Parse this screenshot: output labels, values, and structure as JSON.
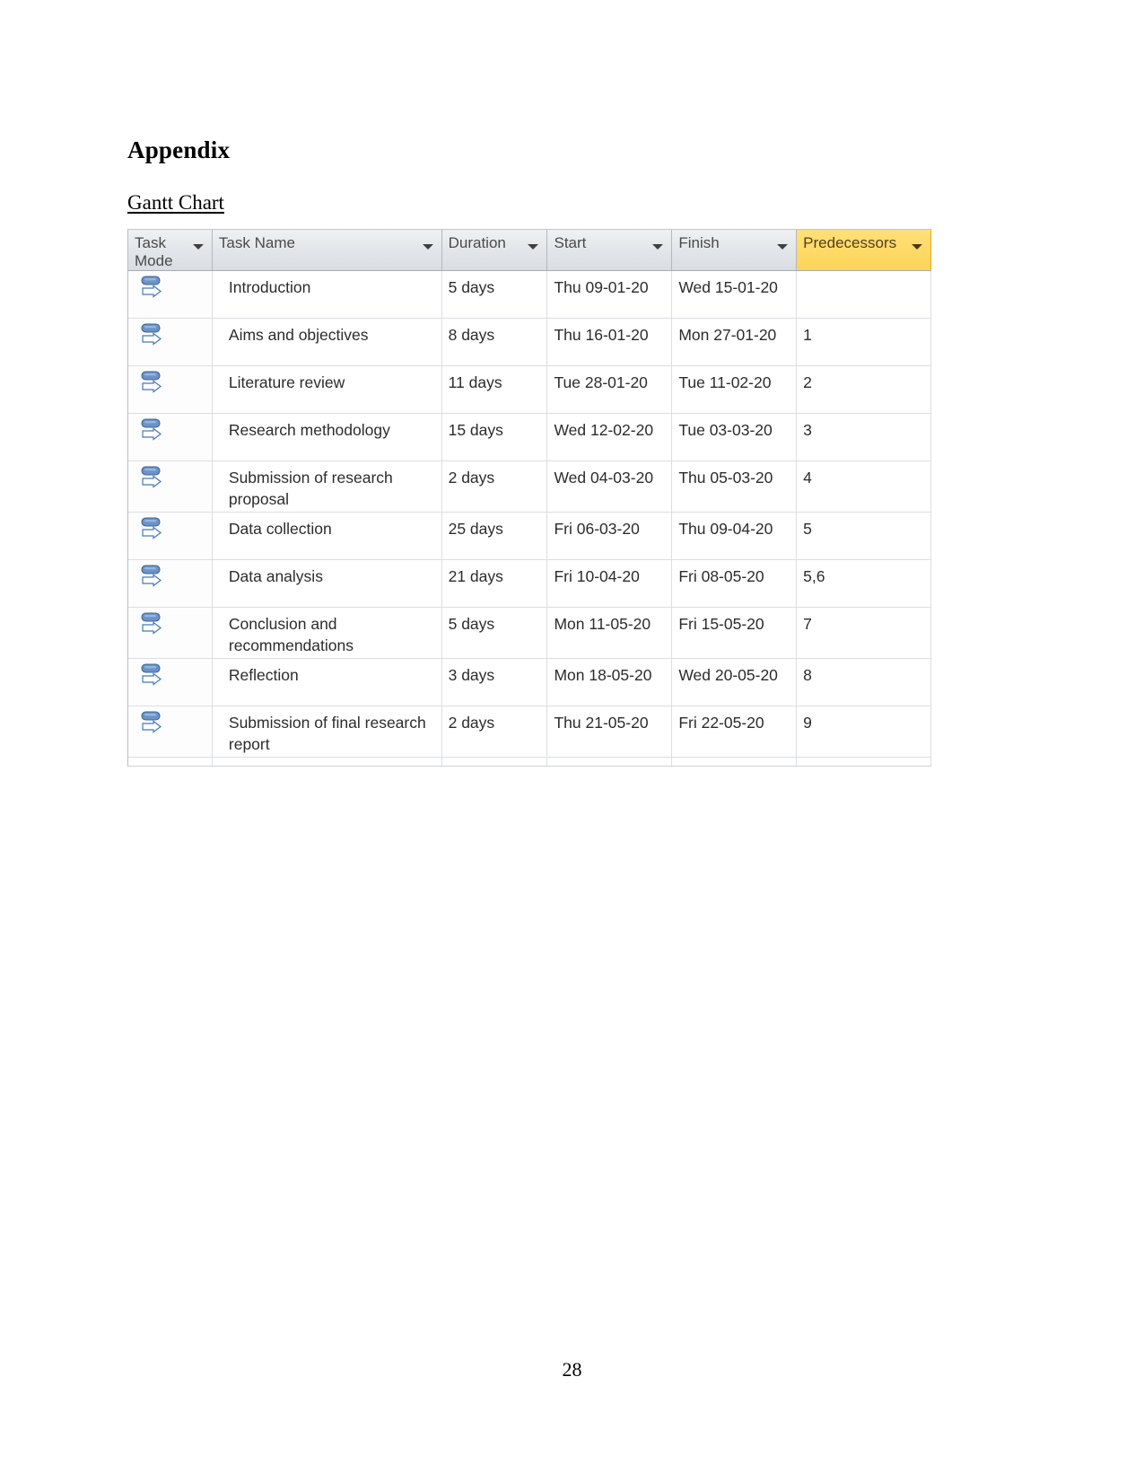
{
  "document": {
    "appendix_heading": "Appendix",
    "section_label": "Gantt Chart",
    "page_number": "28"
  },
  "colors": {
    "header_highlight": "#ffda66",
    "header_background": "#e2e5e9",
    "task_mode_icon": "#5b83b8",
    "grid_line": "#dcdee1"
  },
  "table": {
    "columns": [
      {
        "key": "mode",
        "label": "Task\nMode",
        "icon": "chevron-down-icon",
        "highlighted": false
      },
      {
        "key": "name",
        "label": "Task Name",
        "icon": "chevron-down-icon",
        "highlighted": false
      },
      {
        "key": "dur",
        "label": "Duration",
        "icon": "chevron-down-icon",
        "highlighted": false
      },
      {
        "key": "start",
        "label": "Start",
        "icon": "chevron-down-icon",
        "highlighted": false
      },
      {
        "key": "finish",
        "label": "Finish",
        "icon": "chevron-down-icon",
        "highlighted": false
      },
      {
        "key": "pred",
        "label": "Predecessors",
        "icon": "chevron-down-icon",
        "highlighted": true
      }
    ],
    "rows": [
      {
        "mode_icon": "auto-scheduled-icon",
        "name": "Introduction",
        "duration": "5 days",
        "start": "Thu 09-01-20",
        "finish": "Wed 15-01-20",
        "predecessors": ""
      },
      {
        "mode_icon": "auto-scheduled-icon",
        "name": "Aims and objectives",
        "duration": "8 days",
        "start": "Thu 16-01-20",
        "finish": "Mon 27-01-20",
        "predecessors": "1"
      },
      {
        "mode_icon": "auto-scheduled-icon",
        "name": "Literature review",
        "duration": "11 days",
        "start": "Tue 28-01-20",
        "finish": "Tue 11-02-20",
        "predecessors": "2"
      },
      {
        "mode_icon": "auto-scheduled-icon",
        "name": "Research methodology",
        "duration": "15 days",
        "start": "Wed 12-02-20",
        "finish": "Tue 03-03-20",
        "predecessors": "3"
      },
      {
        "mode_icon": "auto-scheduled-icon",
        "name": "Submission of research proposal",
        "duration": "2 days",
        "start": "Wed 04-03-20",
        "finish": "Thu 05-03-20",
        "predecessors": "4"
      },
      {
        "mode_icon": "auto-scheduled-icon",
        "name": "Data collection",
        "duration": "25 days",
        "start": "Fri 06-03-20",
        "finish": "Thu 09-04-20",
        "predecessors": "5"
      },
      {
        "mode_icon": "auto-scheduled-icon",
        "name": "Data analysis",
        "duration": "21 days",
        "start": "Fri 10-04-20",
        "finish": "Fri 08-05-20",
        "predecessors": "5,6"
      },
      {
        "mode_icon": "auto-scheduled-icon",
        "name": "Conclusion and recommendations",
        "duration": "5 days",
        "start": "Mon 11-05-20",
        "finish": "Fri 15-05-20",
        "predecessors": "7"
      },
      {
        "mode_icon": "auto-scheduled-icon",
        "name": "Reflection",
        "duration": "3 days",
        "start": "Mon 18-05-20",
        "finish": "Wed 20-05-20",
        "predecessors": "8"
      },
      {
        "mode_icon": "auto-scheduled-icon",
        "name": "Submission of final research report",
        "duration": "2 days",
        "start": "Thu 21-05-20",
        "finish": "Fri 22-05-20",
        "predecessors": "9"
      }
    ]
  }
}
